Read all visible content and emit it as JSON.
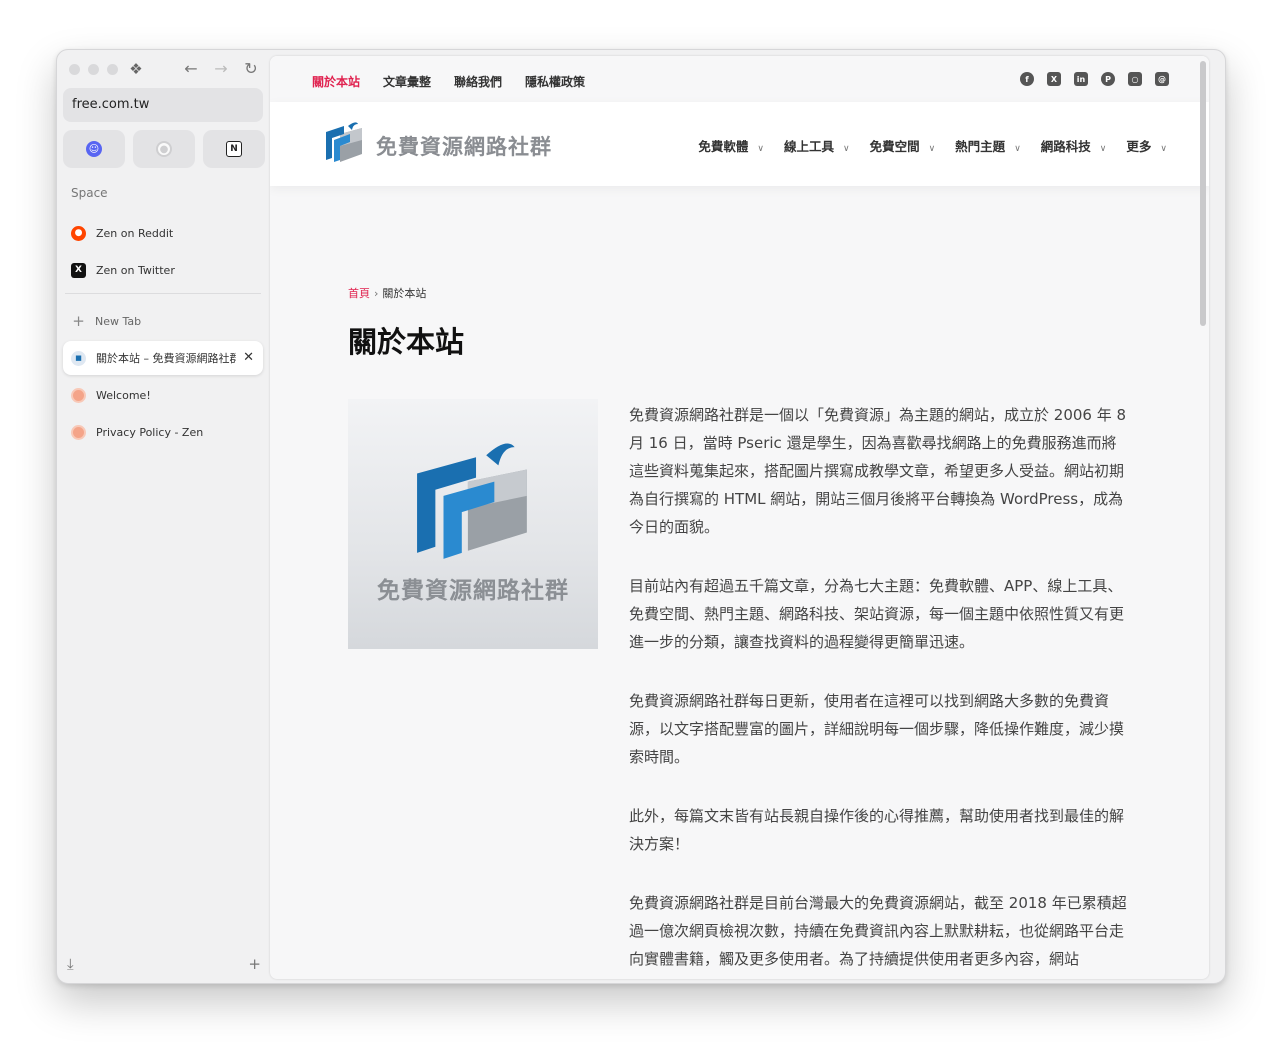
{
  "browser": {
    "url": "free.com.tw",
    "space_label": "Space",
    "pinned_tabs": [
      {
        "name": "Discord",
        "icon": "discord-icon",
        "color": "#5865F2"
      },
      {
        "name": "GitHub",
        "icon": "github-icon",
        "color": "#cfcfd1"
      },
      {
        "name": "Notion",
        "icon": "notion-icon",
        "color": "#222222"
      }
    ],
    "space_tabs": [
      {
        "label": "Zen on Reddit",
        "icon": "reddit-icon",
        "color": "#FF4500"
      },
      {
        "label": "Zen on Twitter",
        "icon": "x-icon",
        "color": "#111111"
      }
    ],
    "new_tab_label": "New Tab",
    "open_tabs": [
      {
        "label": "關於本站 – 免費資源網路社群",
        "icon": "free-com-tw-icon",
        "active": true
      },
      {
        "label": "Welcome!",
        "icon": "zen-icon",
        "active": false
      },
      {
        "label": "Privacy Policy - Zen",
        "icon": "zen-icon",
        "active": false
      }
    ]
  },
  "site": {
    "top_nav": [
      "關於本站",
      "文章彙整",
      "聯絡我們",
      "隱私權政策"
    ],
    "social_icons": [
      "facebook-icon",
      "x-icon",
      "linkedin-icon",
      "pinterest-icon",
      "instagram-icon",
      "threads-icon"
    ],
    "name": "免費資源網路社群",
    "main_nav": [
      "免費軟體",
      "線上工具",
      "免費空間",
      "熱門主題",
      "網路科技",
      "更多"
    ],
    "accent_color": "#e0224f"
  },
  "page": {
    "breadcrumb_home": "首頁",
    "breadcrumb_current": "關於本站",
    "title": "關於本站",
    "image_text": "免費資源網路社群",
    "paragraphs": [
      "免費資源網路社群是一個以「免費資源」為主題的網站，成立於 2006 年 8 月 16 日，當時 Pseric 還是學生，因為喜歡尋找網路上的免費服務進而將這些資料蒐集起來，搭配圖片撰寫成教學文章，希望更多人受益。網站初期為自行撰寫的 HTML 網站，開站三個月後將平台轉換為 WordPress，成為今日的面貌。",
      "目前站內有超過五千篇文章，分為七大主題：免費軟體、APP、線上工具、免費空間、熱門主題、網路科技、架站資源，每一個主題中依照性質又有更進一步的分類，讓查找資料的過程變得更簡單迅速。",
      "免費資源網路社群每日更新，使用者在這裡可以找到網路大多數的免費資源，以文字搭配豐富的圖片，詳細說明每一個步驟，降低操作難度，減少摸索時間。",
      "此外，每篇文末皆有站長親自操作後的心得推薦，幫助使用者找到最佳的解決方案！",
      "免費資源網路社群是目前台灣最大的免費資源網站，截至 2018 年已累積超過一億次網頁檢視次數，持續在免費資訊內容上默默耕耘，也從網路平台走向實體書籍，觸及更多使用者。為了持續提供使用者更多內容，網站"
    ]
  }
}
